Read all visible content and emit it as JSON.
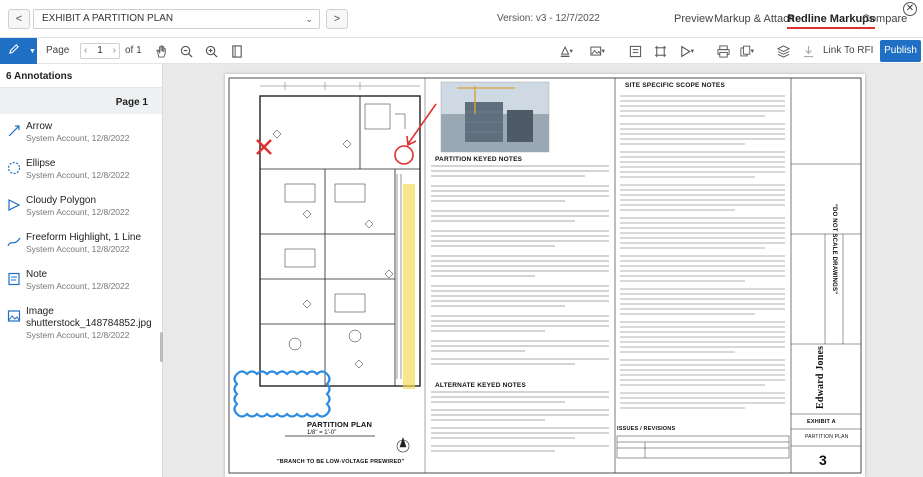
{
  "header": {
    "prev_label": "<",
    "next_label": ">",
    "document_name": "EXHIBIT A PARTITION PLAN",
    "version": "Version: v3 - 12/7/2022",
    "tabs": [
      {
        "label": "Preview"
      },
      {
        "label": "Markup & Attach"
      },
      {
        "label": "Redline Markups"
      },
      {
        "label": "Compare"
      }
    ],
    "close_symbol": "✕"
  },
  "toolbar": {
    "page_label": "Page",
    "page_value": "1",
    "page_of": "of 1",
    "link_rfi_label": "Link To RFI",
    "publish_label": "Publish"
  },
  "sidebar": {
    "title": "6 Annotations",
    "page_header": "Page 1",
    "annotations": [
      {
        "type": "Arrow",
        "meta": "System Account, 12/8/2022",
        "icon": "arrow-icon"
      },
      {
        "type": "Ellipse",
        "meta": "System Account, 12/8/2022",
        "icon": "ellipse-icon"
      },
      {
        "type": "Cloudy Polygon",
        "meta": "System Account, 12/8/2022",
        "icon": "cloud-polygon-icon"
      },
      {
        "type": "Freeform Highlight, 1 Line",
        "meta": "System Account, 12/8/2022",
        "icon": "highlight-icon"
      },
      {
        "type": "Note",
        "meta": "System Account, 12/8/2022",
        "icon": "note-icon"
      },
      {
        "type": "Image",
        "filename": "shutterstock_148784852.jpg",
        "meta": "System Account, 12/8/2022",
        "icon": "image-icon"
      }
    ]
  },
  "drawing": {
    "scope_title": "SITE SPECIFIC SCOPE NOTES",
    "partition_notes_title": "PARTITION KEYED NOTES",
    "alternate_notes_title": "ALTERNATE KEYED NOTES",
    "plan_title": "PARTITION PLAN",
    "plan_scale": "1/8\" = 1'-0\"",
    "branch_note": "\"BRANCH TO BE LOW-VOLTAGE PREWIRED\"",
    "do_not_scale": "\"DO NOT SCALE DRAWINGS\"",
    "brand": "Edward Jones",
    "exhibit": "EXHIBIT A",
    "sheet_title": "PARTITION PLAN",
    "sheet_number": "3",
    "issues_title": "ISSUES / REVISIONS"
  },
  "colors": {
    "accent": "#1f6fc5",
    "markup_red": "#e03131",
    "highlight_yellow": "#f2d94e",
    "cloud_blue": "#2a8be0"
  }
}
